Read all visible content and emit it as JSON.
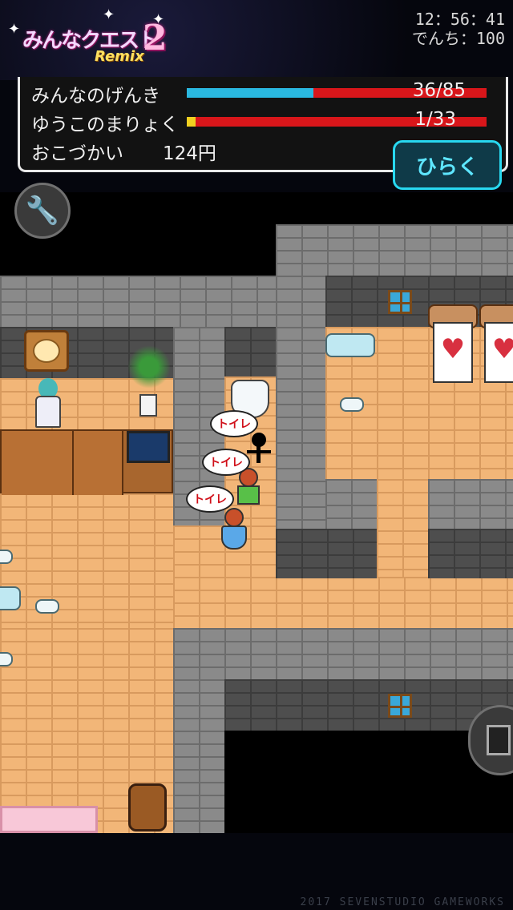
{
  "header": {
    "logo_text": "みんなクエスト",
    "logo_number": "2",
    "logo_subtitle": "Remix",
    "time": "12：56：41",
    "battery": "でんち：100"
  },
  "status": {
    "hp_label": "みんなのげんき",
    "hp_value": "36/85",
    "hp_current": 36,
    "hp_max": 85,
    "mp_label": "ゆうこのまりょく",
    "mp_value": "1/33",
    "mp_current": 1,
    "mp_max": 33,
    "money_label": "おこづかい",
    "money_value": "124円"
  },
  "buttons": {
    "open_label": "ひらく"
  },
  "map": {
    "speech": [
      "トイレ",
      "トイレ",
      "トイレ"
    ]
  },
  "footer": {
    "copyright": "2017 SEVENSTUDIO GAMEWORKS"
  },
  "colors": {
    "hp_fill": "#2ab8e0",
    "mp_fill": "#f0d020",
    "bar_empty": "#d8161a",
    "accent": "#28d8f0"
  }
}
